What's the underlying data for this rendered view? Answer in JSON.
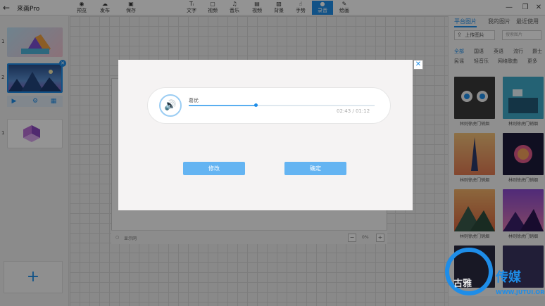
{
  "app": {
    "title": "来画Pro",
    "back_icon": "back-arrow-icon"
  },
  "toolbar": {
    "items": [
      {
        "label": "预览",
        "icon": "eye-icon"
      },
      {
        "label": "发布",
        "icon": "cloud-upload-icon"
      },
      {
        "label": "保存",
        "icon": "save-icon"
      },
      {
        "label": "文字",
        "icon": "text-icon"
      },
      {
        "label": "视频",
        "icon": "video-frame-icon"
      },
      {
        "label": "音乐",
        "icon": "music-icon"
      },
      {
        "label": "视频",
        "icon": "film-icon"
      },
      {
        "label": "背景",
        "icon": "background-icon"
      },
      {
        "label": "手势",
        "icon": "hand-gesture-icon"
      },
      {
        "label": "录音",
        "icon": "microphone-icon"
      },
      {
        "label": "绘画",
        "icon": "pencil-icon"
      }
    ],
    "active_label": "录音",
    "accent_color": "#1e8de8"
  },
  "window_controls": {
    "minimize": "—",
    "maximize": "❐",
    "close": "✕"
  },
  "slides": {
    "numbers": [
      "1",
      "2",
      "1"
    ],
    "add_label": "+"
  },
  "right_panel": {
    "tabs": [
      "平台图片",
      "我的图片",
      "最近使用"
    ],
    "upload_label": "上传图片",
    "search_placeholder": "搜索图片",
    "filters_row1": [
      "全部",
      "国语",
      "英语",
      "流行",
      "爵士"
    ],
    "filters_row2": [
      "民谣",
      "轻音乐",
      "网络歌曲",
      "更多"
    ],
    "tile_captions": [
      "林则徐虎门销烟",
      "林则徐虎门销烟",
      "林则徐虎门销烟",
      "林则徐虎门销烟",
      "林则徐虎门销烟",
      "林则徐虎门销烟"
    ]
  },
  "stage": {
    "status_items": [
      "显示网",
      "",
      "",
      "",
      "",
      "",
      ""
    ],
    "zoom_out": "−",
    "zoom_level": "0%",
    "zoom_in": "+"
  },
  "modal": {
    "close_label": "✕",
    "audio": {
      "track_name": "葛优",
      "time": "02:43 / 01:12",
      "progress": 0.36
    },
    "modify_label": "修改",
    "confirm_label": "确定"
  },
  "watermark": {
    "logo_text": "古雅",
    "brand": "传媒",
    "url": "WWW.JUTUI.ORG"
  }
}
